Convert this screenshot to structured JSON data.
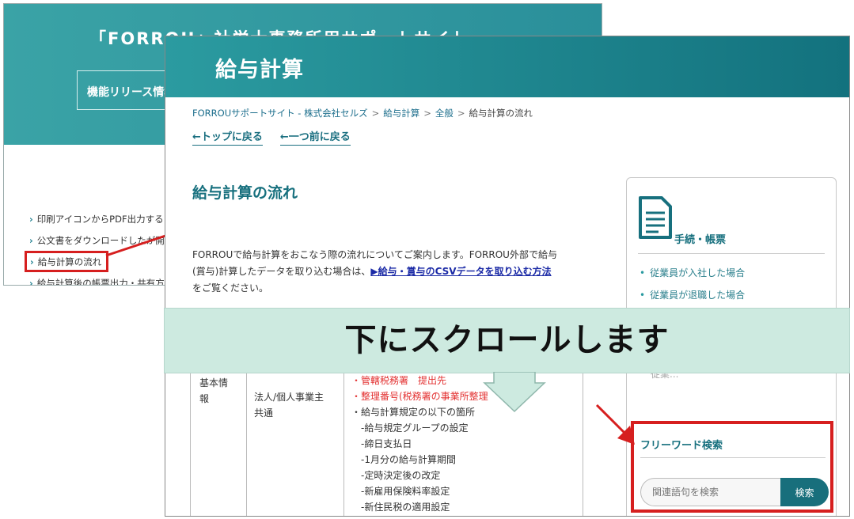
{
  "back_window": {
    "site_title": "「FORROU」社労士事務所用サポートサイト",
    "release_button": "機能リリース情報",
    "links": [
      "印刷アイコンからPDF出力すると",
      "公文書をダウンロードしたが開",
      "給与計算の流れ",
      "給与計算後の帳票出力・共有方法"
    ]
  },
  "front_window": {
    "header_title": "給与計算",
    "breadcrumb": {
      "items": [
        "FORROUサポートサイト - 株式会社セルズ",
        "給与計算",
        "全般"
      ],
      "current": "給与計算の流れ",
      "separator": ">"
    },
    "back_links": {
      "top": "←トップに戻る",
      "previous": "←一つ前に戻る"
    },
    "page_heading": "給与計算の流れ",
    "intro": {
      "line1": "FORROUで給与計算をおこなう際の流れについてご案内します。FORROU外部で給与",
      "line2_prefix": "(賞与)計算したデータを取り込む場合は、",
      "csv_link": "▶給与・賞与のCSVデータを取り込む方法",
      "line3": "をご覧ください。"
    },
    "sidebar": {
      "heading": "手続・帳票",
      "items": [
        "従業員が入社した場合",
        "従業員が退職した場合"
      ],
      "partial_item": "従業..."
    },
    "table": {
      "col1": [
        "基本情",
        "報"
      ],
      "col2": [
        "法人/個人事業主",
        "共通"
      ],
      "col3_red": [
        "・管轄税務署　提出先",
        "・整理番号(税務署の事業所整理"
      ],
      "col3": [
        "・給与計算規定の以下の箇所",
        "　-給与規定グループの設定",
        "　-締日支払日",
        "　-1月分の給与計算期間",
        "　-定時決定後の改定",
        "　-新雇用保険料率設定",
        "　-新住民税の適用設定"
      ]
    },
    "search": {
      "title": "フリーワード検索",
      "placeholder": "関連語句を検索",
      "button": "検索"
    }
  },
  "overlay": {
    "scroll_text": "下にスクロールします"
  },
  "colors": {
    "teal": "#17707e",
    "highlight_red": "#d61f1f",
    "banner_bg": "#cdeae0"
  }
}
